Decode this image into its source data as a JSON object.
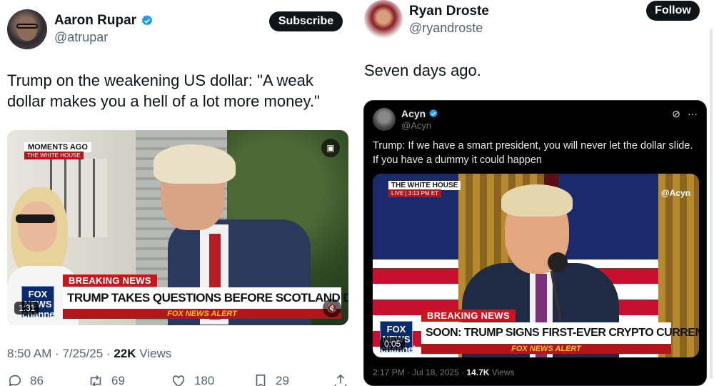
{
  "left_tweet": {
    "author": {
      "name": "Aaron Rupar",
      "handle": "@atrupar"
    },
    "subscribe_label": "Subscribe",
    "text": "Trump on the weakening US dollar: \"A weak dollar makes you a hell of a lot more money.\"",
    "video": {
      "overlay_top": "MOMENTS AGO",
      "overlay_sub": "THE WHITE HOUSE",
      "breaking": "BREAKING NEWS",
      "headline": "TRUMP TAKES QUESTIONS BEFORE SCOTLAND DEPARTURE",
      "alert": "FOX NEWS ALERT",
      "network": "FOX NEWS channel",
      "time": "1:31"
    },
    "timestamp": "8:50 AM · 7/25/25 · ",
    "views_count": "22K",
    "views_label": " Views",
    "actions": {
      "replies": "86",
      "reposts": "69",
      "likes": "180",
      "bookmarks": "29"
    }
  },
  "right_tweet": {
    "author": {
      "name": "Ryan Droste",
      "handle": "@ryandroste"
    },
    "follow_label": "Follow",
    "text": "Seven days ago.",
    "quote": {
      "author": {
        "name": "Acyn",
        "handle": "@Acyn"
      },
      "text": "Trump: If we have a smart president, you will never let the dollar slide. If you have a dummy it could happen",
      "video": {
        "overlay_top": "THE WHITE HOUSE",
        "overlay_sub": "LIVE | 3:13 PM ET",
        "watermark": "@Acyn",
        "breaking": "BREAKING NEWS",
        "headline": "SOON: TRUMP SIGNS FIRST-EVER CRYPTO CURRENCY BILL",
        "alert": "FOX NEWS ALERT",
        "network": "FOX NEWS channel",
        "time": "0:05"
      },
      "timestamp": "2:17 PM · Jul 18, 2025 · ",
      "views_count": "14.7K",
      "views_label": " Views"
    }
  },
  "colors": {
    "accent_blue": "#1d9bf0",
    "text_primary": "#0f1419",
    "text_secondary": "#536471",
    "fox_red": "#c7171c"
  },
  "icons": [
    "verified-badge-icon",
    "reply-icon",
    "repost-icon",
    "like-icon",
    "bookmark-icon",
    "share-icon",
    "captions-icon",
    "mute-icon",
    "more-icon",
    "grok-icon"
  ]
}
